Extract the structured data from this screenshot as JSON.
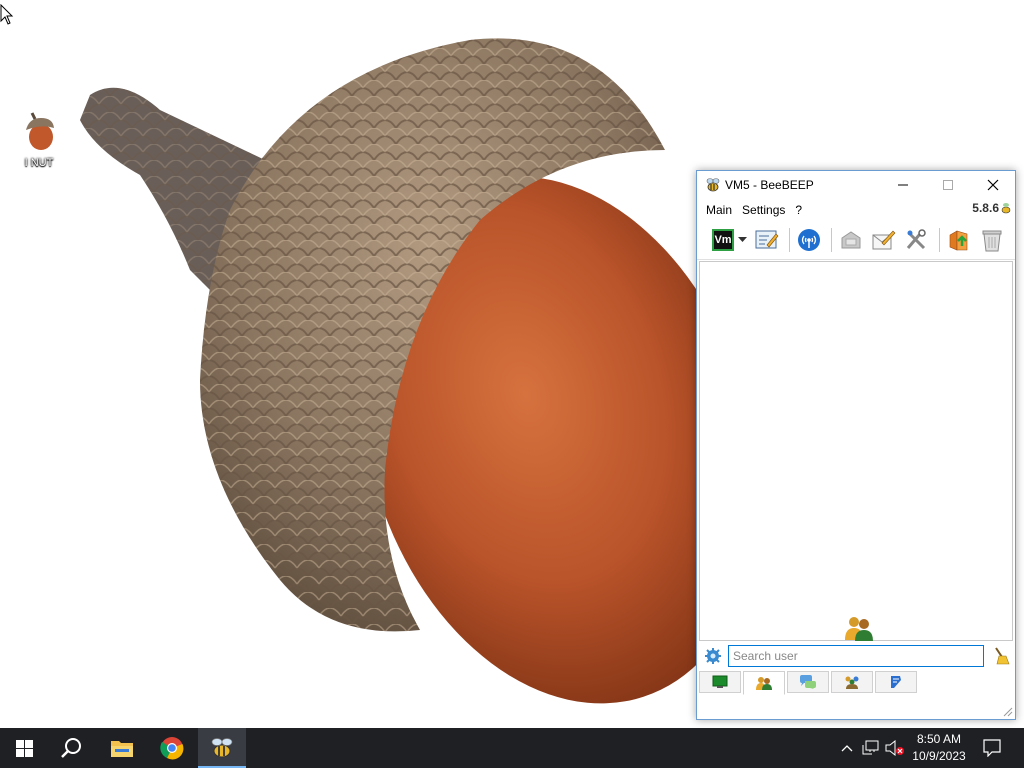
{
  "desktop": {
    "icons": [
      {
        "label": "I NUT",
        "icon": "acorn-icon"
      }
    ]
  },
  "window": {
    "title": "VM5 - BeeBEEP",
    "app_icon": "bee-icon",
    "controls": {
      "minimize": "minimize-icon",
      "maximize": "maximize-icon",
      "close": "close-icon"
    },
    "menu": [
      "Main",
      "Settings",
      "?"
    ],
    "version": "5.8.6",
    "toolbar": {
      "status_button": "Vm",
      "status_dropdown_icon": "caret-down-icon",
      "items": [
        "edit-profile-icon",
        "broadcast-icon",
        "share-files-icon",
        "write-message-icon",
        "plugins-icon",
        "update-icon",
        "trash-icon"
      ]
    },
    "user_list": {
      "empty_icon": "users-icon",
      "users": []
    },
    "search": {
      "value": "",
      "placeholder": "Search user",
      "settings_icon": "gear-icon",
      "clear_icon": "broom-icon"
    },
    "tabs": [
      {
        "icon": "computer-icon",
        "active": false
      },
      {
        "icon": "users-icon",
        "active": true
      },
      {
        "icon": "chat-icon",
        "active": false
      },
      {
        "icon": "groups-icon",
        "active": false
      },
      {
        "icon": "history-icon",
        "active": false
      }
    ]
  },
  "taskbar": {
    "apps": [
      "windows-start-icon",
      "search-icon",
      "file-explorer-icon",
      "chrome-icon",
      "beebeep-icon"
    ],
    "active_app": "beebeep-icon",
    "tray_icons": [
      "chevron-up-icon",
      "network-icon",
      "volume-muted-icon"
    ],
    "time": "8:50 AM",
    "date": "10/9/2023",
    "notification_icon": "notification-icon"
  },
  "colors": {
    "taskbar_bg": "#1f2024",
    "accent": "#0078d7",
    "acorn_cap": "#8a7560",
    "acorn_nut": "#b9532a"
  }
}
